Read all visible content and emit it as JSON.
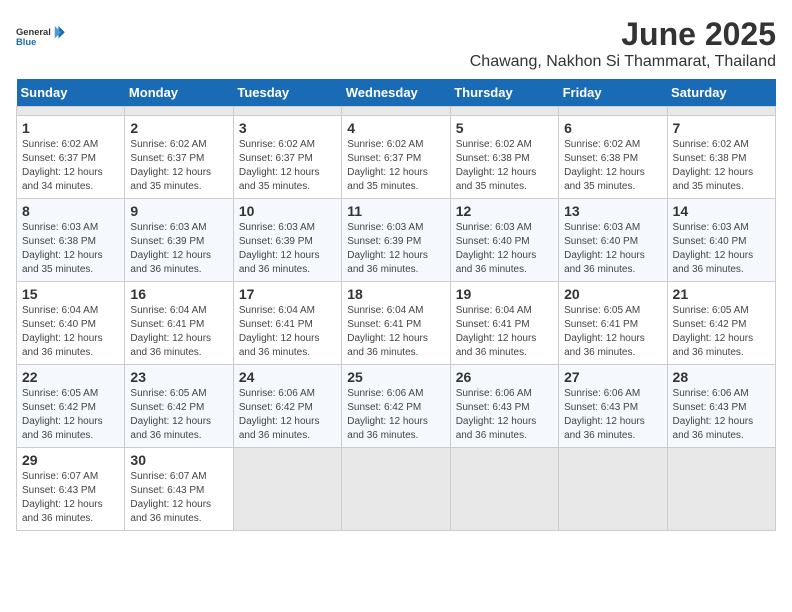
{
  "header": {
    "logo_text_general": "General",
    "logo_text_blue": "Blue",
    "month": "June 2025",
    "location": "Chawang, Nakhon Si Thammarat, Thailand"
  },
  "calendar": {
    "days_of_week": [
      "Sunday",
      "Monday",
      "Tuesday",
      "Wednesday",
      "Thursday",
      "Friday",
      "Saturday"
    ],
    "weeks": [
      [
        {
          "day": "",
          "empty": true
        },
        {
          "day": "",
          "empty": true
        },
        {
          "day": "",
          "empty": true
        },
        {
          "day": "",
          "empty": true
        },
        {
          "day": "",
          "empty": true
        },
        {
          "day": "",
          "empty": true
        },
        {
          "day": "",
          "empty": true
        }
      ],
      [
        {
          "day": "1",
          "sunrise": "6:02 AM",
          "sunset": "6:37 PM",
          "daylight": "12 hours and 34 minutes."
        },
        {
          "day": "2",
          "sunrise": "6:02 AM",
          "sunset": "6:37 PM",
          "daylight": "12 hours and 35 minutes."
        },
        {
          "day": "3",
          "sunrise": "6:02 AM",
          "sunset": "6:37 PM",
          "daylight": "12 hours and 35 minutes."
        },
        {
          "day": "4",
          "sunrise": "6:02 AM",
          "sunset": "6:37 PM",
          "daylight": "12 hours and 35 minutes."
        },
        {
          "day": "5",
          "sunrise": "6:02 AM",
          "sunset": "6:38 PM",
          "daylight": "12 hours and 35 minutes."
        },
        {
          "day": "6",
          "sunrise": "6:02 AM",
          "sunset": "6:38 PM",
          "daylight": "12 hours and 35 minutes."
        },
        {
          "day": "7",
          "sunrise": "6:02 AM",
          "sunset": "6:38 PM",
          "daylight": "12 hours and 35 minutes."
        }
      ],
      [
        {
          "day": "8",
          "sunrise": "6:03 AM",
          "sunset": "6:38 PM",
          "daylight": "12 hours and 35 minutes."
        },
        {
          "day": "9",
          "sunrise": "6:03 AM",
          "sunset": "6:39 PM",
          "daylight": "12 hours and 36 minutes."
        },
        {
          "day": "10",
          "sunrise": "6:03 AM",
          "sunset": "6:39 PM",
          "daylight": "12 hours and 36 minutes."
        },
        {
          "day": "11",
          "sunrise": "6:03 AM",
          "sunset": "6:39 PM",
          "daylight": "12 hours and 36 minutes."
        },
        {
          "day": "12",
          "sunrise": "6:03 AM",
          "sunset": "6:40 PM",
          "daylight": "12 hours and 36 minutes."
        },
        {
          "day": "13",
          "sunrise": "6:03 AM",
          "sunset": "6:40 PM",
          "daylight": "12 hours and 36 minutes."
        },
        {
          "day": "14",
          "sunrise": "6:03 AM",
          "sunset": "6:40 PM",
          "daylight": "12 hours and 36 minutes."
        }
      ],
      [
        {
          "day": "15",
          "sunrise": "6:04 AM",
          "sunset": "6:40 PM",
          "daylight": "12 hours and 36 minutes."
        },
        {
          "day": "16",
          "sunrise": "6:04 AM",
          "sunset": "6:41 PM",
          "daylight": "12 hours and 36 minutes."
        },
        {
          "day": "17",
          "sunrise": "6:04 AM",
          "sunset": "6:41 PM",
          "daylight": "12 hours and 36 minutes."
        },
        {
          "day": "18",
          "sunrise": "6:04 AM",
          "sunset": "6:41 PM",
          "daylight": "12 hours and 36 minutes."
        },
        {
          "day": "19",
          "sunrise": "6:04 AM",
          "sunset": "6:41 PM",
          "daylight": "12 hours and 36 minutes."
        },
        {
          "day": "20",
          "sunrise": "6:05 AM",
          "sunset": "6:41 PM",
          "daylight": "12 hours and 36 minutes."
        },
        {
          "day": "21",
          "sunrise": "6:05 AM",
          "sunset": "6:42 PM",
          "daylight": "12 hours and 36 minutes."
        }
      ],
      [
        {
          "day": "22",
          "sunrise": "6:05 AM",
          "sunset": "6:42 PM",
          "daylight": "12 hours and 36 minutes."
        },
        {
          "day": "23",
          "sunrise": "6:05 AM",
          "sunset": "6:42 PM",
          "daylight": "12 hours and 36 minutes."
        },
        {
          "day": "24",
          "sunrise": "6:06 AM",
          "sunset": "6:42 PM",
          "daylight": "12 hours and 36 minutes."
        },
        {
          "day": "25",
          "sunrise": "6:06 AM",
          "sunset": "6:42 PM",
          "daylight": "12 hours and 36 minutes."
        },
        {
          "day": "26",
          "sunrise": "6:06 AM",
          "sunset": "6:43 PM",
          "daylight": "12 hours and 36 minutes."
        },
        {
          "day": "27",
          "sunrise": "6:06 AM",
          "sunset": "6:43 PM",
          "daylight": "12 hours and 36 minutes."
        },
        {
          "day": "28",
          "sunrise": "6:06 AM",
          "sunset": "6:43 PM",
          "daylight": "12 hours and 36 minutes."
        }
      ],
      [
        {
          "day": "29",
          "sunrise": "6:07 AM",
          "sunset": "6:43 PM",
          "daylight": "12 hours and 36 minutes."
        },
        {
          "day": "30",
          "sunrise": "6:07 AM",
          "sunset": "6:43 PM",
          "daylight": "12 hours and 36 minutes."
        },
        {
          "day": "",
          "empty": true
        },
        {
          "day": "",
          "empty": true
        },
        {
          "day": "",
          "empty": true
        },
        {
          "day": "",
          "empty": true
        },
        {
          "day": "",
          "empty": true
        }
      ]
    ]
  }
}
